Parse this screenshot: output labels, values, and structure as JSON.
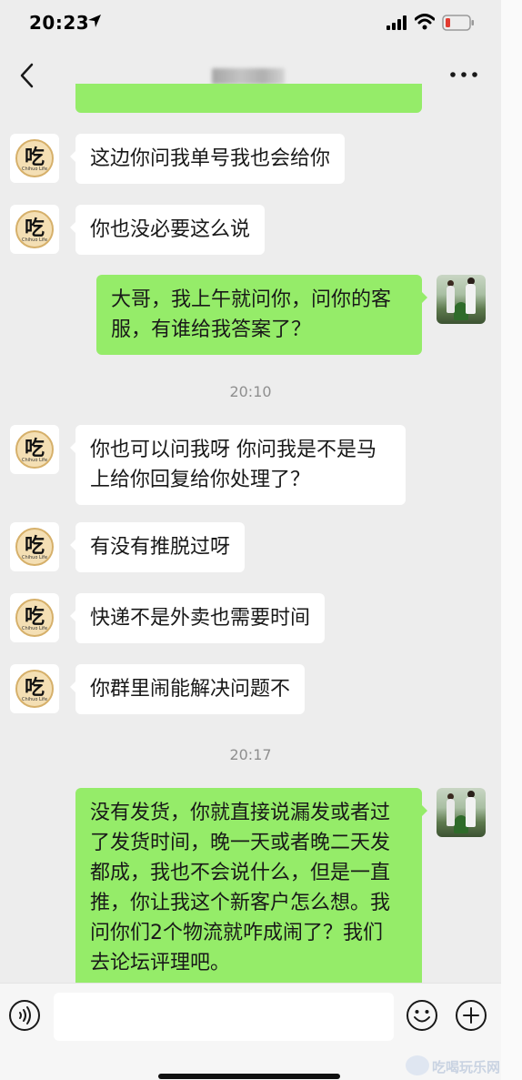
{
  "status_bar": {
    "time": "20:23",
    "icons": [
      "location-arrow-icon",
      "signal-icon",
      "wifi-icon",
      "battery-low-icon"
    ]
  },
  "nav": {
    "back_icon": "chevron-left-icon",
    "more_icon": "more-dots-icon"
  },
  "colors": {
    "outgoing_bubble": "#95ec69",
    "incoming_bubble": "#ffffff",
    "background": "#ededed",
    "battery_low": "#e23b30"
  },
  "contact_avatar": {
    "text": "吃",
    "subtext": "Chihuo Life"
  },
  "messages": [
    {
      "text": "这边你问我单号我也会给你"
    },
    {
      "text": "你也没必要这么说"
    },
    {
      "text": "大哥，我上午就问你，问你的客\n服，有谁给我答案了？"
    },
    {
      "text": "你也可以问我呀 你问我是不是马\n上给你回复给你处理了？"
    },
    {
      "text": "有没有推脱过呀"
    },
    {
      "text": "快递不是外卖也需要时间"
    },
    {
      "text": "你群里闹能解决问题不"
    },
    {
      "text": "没有发货，你就直接说漏发或者过\n了发货时间，晚一天或者晚二天发\n都成，我也不会说什么，但是一直\n推，你让我这个新客户怎么想。我\n问你们2个物流就咋成闹了？我们\n去论坛评理吧。"
    }
  ],
  "timestamps": [
    "20:10",
    "20:17"
  ],
  "input_bar": {
    "icons": [
      "voice-icon",
      "emoji-icon",
      "plus-icon"
    ]
  },
  "watermark": "吃喝玩乐网"
}
